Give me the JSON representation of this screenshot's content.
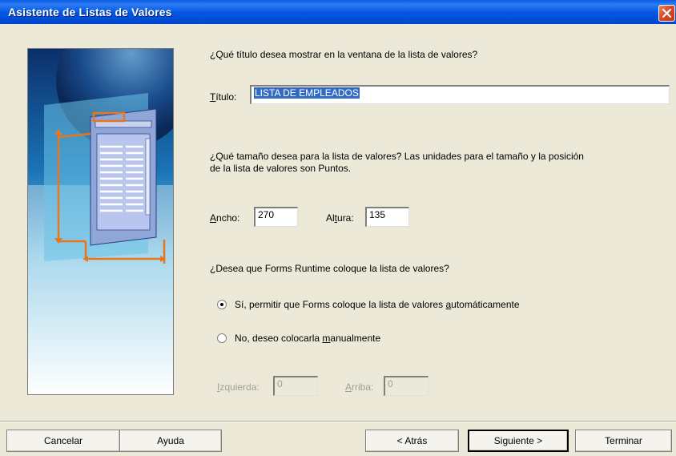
{
  "window": {
    "title": "Asistente de Listas de Valores"
  },
  "question_title": "¿Qué título desea mostrar en la ventana de la lista de valores?",
  "title_field": {
    "label_pre": "",
    "label_accel": "T",
    "label_post": "ítulo:",
    "value": "LISTA DE EMPLEADOS"
  },
  "question_size_line1": "¿Qué tamaño desea para la lista de valores? Las unidades para el tamaño y la posición",
  "question_size_line2": "de la lista de valores son Puntos.",
  "width_field": {
    "label_accel": "A",
    "label_post": "ncho:",
    "value": "270"
  },
  "height_field": {
    "label_pre": "Al",
    "label_accel": "t",
    "label_post": "ura:",
    "value": "135"
  },
  "question_position": "¿Desea que Forms Runtime coloque la lista de valores?",
  "radio_yes": {
    "pre": "Sí, permitir que Forms coloque la lista de valores ",
    "accel": "a",
    "post": "utomáticamente",
    "checked": true
  },
  "radio_no": {
    "pre": "No, deseo colocarla ",
    "accel": "m",
    "post": "anualmente",
    "checked": false
  },
  "left_field": {
    "label_accel": "I",
    "label_post": "zquierda:",
    "value": "0"
  },
  "top_field": {
    "label_accel": "A",
    "label_post": "rriba:",
    "value": "0"
  },
  "buttons": {
    "cancel": "Cancelar",
    "help": "Ayuda",
    "back": "< Atrás",
    "next": "Siguiente >",
    "finish": "Terminar"
  },
  "colors": {
    "titlebar": "#0054e3",
    "selection": "#316ac5",
    "dialog": "#ece9d8",
    "orange": "#e8761c"
  }
}
